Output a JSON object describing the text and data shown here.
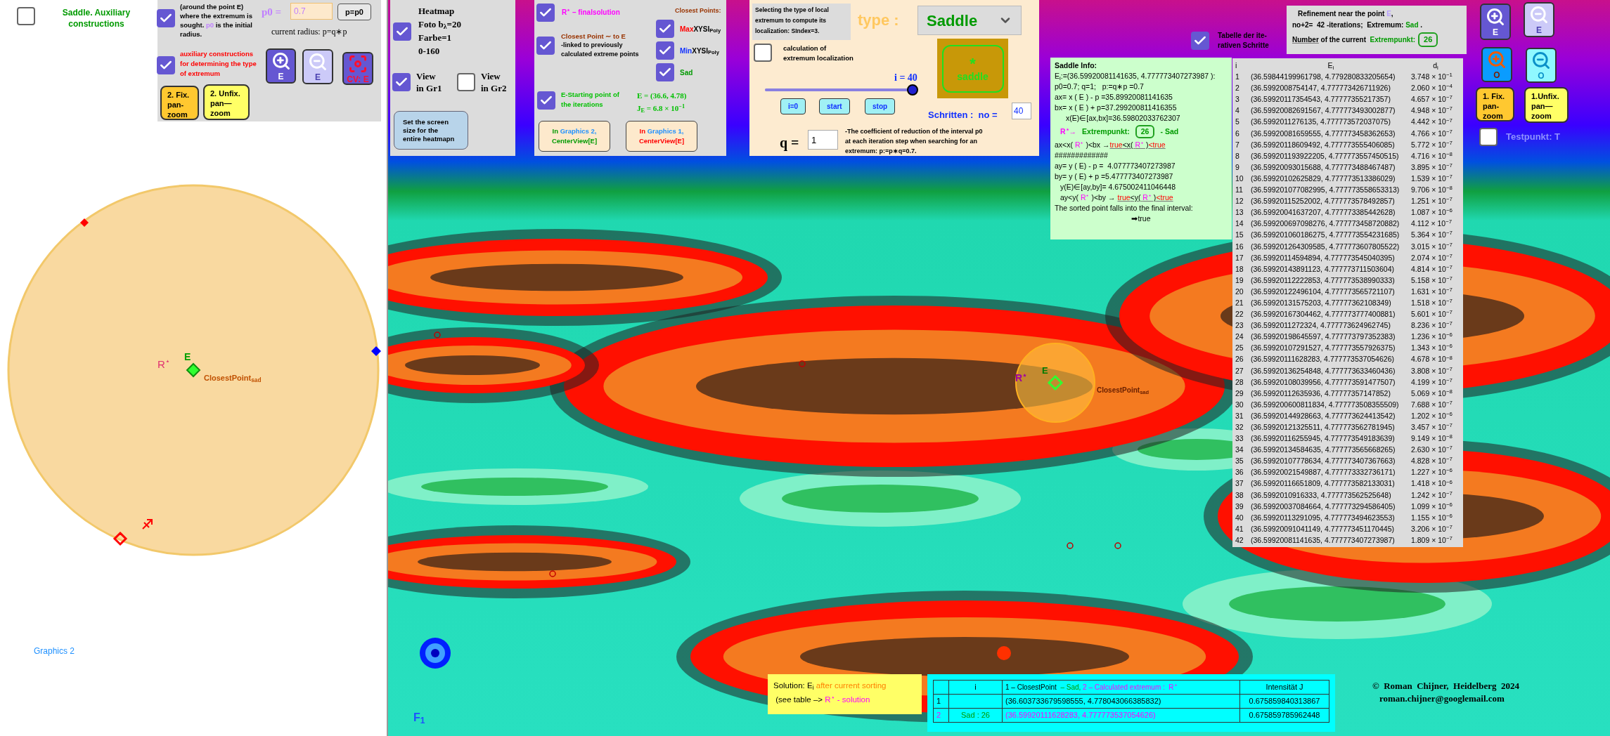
{
  "graphics_2": {
    "aux_checkbox": {
      "checked": false,
      "label": "Saddle. Auxiliary constructions"
    },
    "labels": {
      "r_star": "R$^{⋆}$",
      "e": "E",
      "closest": "ClosestPoint$_{sad}$"
    },
    "view_label": "Graphics 2"
  },
  "radius_panel": {
    "radius_option": {
      "checked": true,
      "segs": [
        {
          "t": "(around the point E) where the extremum is sought. ",
          "kind": "dark"
        },
        {
          "t": "p0",
          "kind": "violet"
        },
        {
          "t": " is the initial radius.",
          "kind": "dark"
        }
      ]
    },
    "p0_label": "p0 =",
    "p0_value": "0.7",
    "p0_button": "p=p0",
    "radius_text": "current radius: p=q∗p",
    "aux_option": {
      "checked": true,
      "label": "auxiliary constructions for determining the type of extremum"
    },
    "zoom_buttons": [
      {
        "kind": "zoom_in",
        "label": "E"
      },
      {
        "kind": "zoom_out",
        "label": "E"
      },
      {
        "kind": "center",
        "label": "CV: E"
      }
    ],
    "pan_buttons": [
      {
        "kind": "fix",
        "label": "2. Fix.\npan-\nzoom"
      },
      {
        "kind": "unfix",
        "label": "2. Unfix.\npan—\nzoom"
      }
    ]
  },
  "heatmap_panel": {
    "heatmap": {
      "checked": true,
      "lines": [
        "Heatmap",
        "Foto b$_{λ}$=20",
        "Farbe=1",
        "0-160"
      ]
    },
    "views": [
      {
        "label": "View\nin Gr1",
        "checked": true
      },
      {
        "label": "View\nin Gr2",
        "checked": false
      }
    ],
    "screen_button": "Set the screen\n size for the\nentire heatmapn"
  },
  "points_panel": {
    "final_solution": {
      "checked": true,
      "label": "R$^{⋆}$ – finalsolution"
    },
    "closest_heading": "Closest Points:",
    "closest_point": {
      "checked": true,
      "title": "Closest Point ∼ to E",
      "note": "-linked to previously calculated extreme points"
    },
    "poly_options": [
      {
        "kind": "max",
        "checked": true,
        "prefix": "Max",
        "label": "XYSI$_{Poly}$"
      },
      {
        "kind": "min",
        "checked": true,
        "prefix": "Min",
        "label": "XYSI$_{Poly}$"
      },
      {
        "kind": "sad",
        "checked": true,
        "label": "Sad"
      }
    ],
    "starting": {
      "checked": true,
      "label": "E-Starting point of the iterations",
      "e_value": "E = (36.6, 4.78)",
      "j_value": "J$_{E}$ = 6.8 × 10$^{−1}$"
    },
    "center_buttons": [
      {
        "segs": [
          {
            "t": "In ",
            "kind": "green"
          },
          {
            "t": "Graphics 2,",
            "kind": "blue"
          },
          {
            "t": "\nCenterView[E]",
            "kind": "green"
          }
        ]
      },
      {
        "segs": [
          {
            "t": "In ",
            "kind": "red"
          },
          {
            "t": "Graphics 1,",
            "kind": "blue"
          },
          {
            "t": "\nCenterView[E]",
            "kind": "red"
          }
        ]
      }
    ]
  },
  "type_panel": {
    "hint": "Selecting the type of local extremum to compute its localization: SIndex=3.",
    "type_label": "type :",
    "type_value": "Saddle",
    "calc_option": {
      "checked": false,
      "label": "calculation of\nextremum localization"
    },
    "slider": {
      "label": "i = 40",
      "level": 1
    },
    "buttons": [
      "i=0",
      "start",
      "stop"
    ],
    "badge": {
      "symbol": "*",
      "label": "saddle"
    },
    "steps": {
      "label": "Schritten :  no =",
      "value": "40"
    },
    "q": {
      "label": "q =",
      "value": "1"
    },
    "description": "-The coefficient of reduction of the interval p0\nat each iteration step when searching for an\nextremum: p:=p∗q=0.7."
  },
  "table_option": {
    "checked": true,
    "label": "Tabelle der ite-\nrativen Schritte"
  },
  "refinement": {
    "line1": [
      {
        "t": "Refinement near the point ",
        "kind": "dark"
      },
      {
        "t": "E",
        "kind": "lavender"
      },
      {
        "t": ",",
        "kind": "dark"
      }
    ],
    "line2": [
      {
        "t": "no+2=  42 -iterations;  Extremum: ",
        "kind": "dark"
      },
      {
        "t": "Sad",
        "kind": "green"
      },
      {
        "t": " .",
        "kind": "dark"
      }
    ],
    "line3": [
      {
        "t": "Number",
        "kind": "dark",
        "u": true
      },
      {
        "t": " of the current  ",
        "kind": "dark"
      },
      {
        "t": "Extrempunkt:",
        "kind": "green"
      }
    ],
    "value": "26"
  },
  "saddle_info": {
    "title": "Saddle  Info:",
    "lines_top": [
      {
        "segs": [
          {
            "t": "E$_{i}$:=(36.59920081141635, 4.777773407273987 ):",
            "kind": "dark"
          }
        ]
      },
      {
        "segs": [
          {
            "t": "p0=0.7; q=1;   p:=q∗p =0.7",
            "kind": "dark"
          }
        ]
      },
      {
        "segs": [
          {
            "t": "ax= x ( E ) - p =35.89920081141635",
            "kind": "dark"
          }
        ]
      },
      {
        "segs": [
          {
            "t": "bx= x ( E ) + p=37.299200811416355",
            "kind": "dark"
          }
        ]
      },
      {
        "indent": true,
        "segs": [
          {
            "t": "x(E)∈[ax,bx]=36.59802033762307",
            "kind": "dark"
          }
        ]
      }
    ],
    "extrem": {
      "arrow": "R$^{⋆}$→",
      "label": "Extrempunkt:",
      "value": "26",
      "suffix": "- Sad"
    },
    "lines_bottom": [
      {
        "segs": [
          {
            "t": "ax<x( ",
            "kind": "dark"
          },
          {
            "t": "R$^{⋆}$",
            "kind": "magenta"
          },
          {
            "t": " )<bx →",
            "kind": "dark"
          },
          {
            "t": "true",
            "kind": "red",
            "u": true
          },
          {
            "t": "<x( ",
            "kind": "dark",
            "u": true
          },
          {
            "t": "R$^{⋆}$",
            "kind": "magenta",
            "u": true
          },
          {
            "t": " )",
            "kind": "dark",
            "u": true
          },
          {
            "t": "<true",
            "kind": "red",
            "u": true
          }
        ]
      },
      {
        "segs": [
          {
            "t": "#############",
            "kind": "dark"
          }
        ]
      },
      {
        "segs": [
          {
            "t": "ay= y ( E) - p =  4.077773407273987",
            "kind": "dark"
          }
        ]
      },
      {
        "segs": [
          {
            "t": "by= y ( E) + p =5.477773407273987",
            "kind": "dark"
          }
        ]
      },
      {
        "indent": true,
        "segs": [
          {
            "t": "y(E)∈[ay,by]= 4.675002411046448",
            "kind": "dark"
          }
        ]
      },
      {
        "indent": true,
        "segs": [
          {
            "t": "ay<y( ",
            "kind": "dark"
          },
          {
            "t": "R$^{⋆}$",
            "kind": "magenta"
          },
          {
            "t": " )<by → ",
            "kind": "dark"
          },
          {
            "t": "true",
            "kind": "red",
            "u": true
          },
          {
            "t": "<y( ",
            "kind": "dark",
            "u": true
          },
          {
            "t": "R$^{⋆}$",
            "kind": "magenta",
            "u": true
          },
          {
            "t": " )",
            "kind": "dark",
            "u": true
          },
          {
            "t": "<true",
            "kind": "red",
            "u": true
          }
        ]
      },
      {
        "segs": [
          {
            "t": "The sorted point falls into the final interval:",
            "kind": "dark"
          }
        ]
      },
      {
        "center": true,
        "segs": [
          {
            "t": "➡true",
            "kind": "dark"
          }
        ]
      }
    ]
  },
  "iteration_table": {
    "columns": [
      "i",
      "E$_{i}$",
      "d$_{i}$"
    ],
    "rows": [
      {
        "i": "1",
        "e": "(36.59844199961798, 4.779280833205654)",
        "d": "3.748 × 10$^{−1}$"
      },
      {
        "i": "2",
        "e": "(36.5992008754147, 4.777773426711926)",
        "d": "2.060 × 10$^{−4}$"
      },
      {
        "i": "3",
        "e": "(36.59920117354543, 4.77777355217357)",
        "d": "4.657 × 10$^{−7}$"
      },
      {
        "i": "4",
        "e": "(36.59920082691567, 4.777773493002877)",
        "d": "4.948 × 10$^{−7}$"
      },
      {
        "i": "5",
        "e": "(36.5992011276135, 4.777773572037075)",
        "d": "4.442 × 10$^{−7}$"
      },
      {
        "i": "6",
        "e": "(36.59920081659555, 4.777773458362653)",
        "d": "4.766 × 10$^{−7}$"
      },
      {
        "i": "7",
        "e": "(36.59920118609492, 4.777773555406085)",
        "d": "5.772 × 10$^{−7}$"
      },
      {
        "i": "8",
        "e": "(36.599201193922205, 4.777773557450515)",
        "d": "4.716 × 10$^{−8}$"
      },
      {
        "i": "9",
        "e": "(36.59920093015688, 4.777773488467487)",
        "d": "3.895 × 10$^{−7}$"
      },
      {
        "i": "10",
        "e": "(36.59920102625829, 4.777773513386029)",
        "d": "1.539 × 10$^{−7}$"
      },
      {
        "i": "11",
        "e": "(36.599201077082995, 4.777773558653313)",
        "d": "9.706 × 10$^{−8}$"
      },
      {
        "i": "12",
        "e": "(36.59920115252002, 4.777773578492857)",
        "d": "1.251 × 10$^{−7}$"
      },
      {
        "i": "13",
        "e": "(36.59920041637207, 4.777773385442628)",
        "d": "1.087 × 10$^{−6}$"
      },
      {
        "i": "14",
        "e": "(36.599200697098276, 4.777773458720882)",
        "d": "4.112 × 10$^{−7}$"
      },
      {
        "i": "15",
        "e": "(36.599201060186275, 4.777773554231685)",
        "d": "5.364 × 10$^{−7}$"
      },
      {
        "i": "16",
        "e": "(36.599201264309585, 4.777773607805522)",
        "d": "3.015 × 10$^{−7}$"
      },
      {
        "i": "17",
        "e": "(36.59920114594894, 4.777773545040395)",
        "d": "2.074 × 10$^{−7}$"
      },
      {
        "i": "18",
        "e": "(36.59920143891123, 4.777773711503604)",
        "d": "4.814 × 10$^{−7}$"
      },
      {
        "i": "19",
        "e": "(36.59920112222853, 4.777773538990333)",
        "d": "5.158 × 10$^{−7}$"
      },
      {
        "i": "20",
        "e": "(36.59920122496104, 4.777773565721107)",
        "d": "1.631 × 10$^{−7}$"
      },
      {
        "i": "21",
        "e": "(36.59920131575203, 4.77777362108349)",
        "d": "1.518 × 10$^{−7}$"
      },
      {
        "i": "22",
        "e": "(36.59920167304462, 4.777773777400881)",
        "d": "5.601 × 10$^{−7}$"
      },
      {
        "i": "23",
        "e": "(36.5992011272324, 4.777773624962745)",
        "d": "8.236 × 10$^{−7}$"
      },
      {
        "i": "24",
        "e": "(36.59920198645597, 4.777773797352383)",
        "d": "1.236 × 10$^{−6}$"
      },
      {
        "i": "25",
        "e": "(36.59920107291527, 4.777773557926375)",
        "d": "1.343 × 10$^{−6}$"
      },
      {
        "i": "26",
        "e": "(36.59920111628283, 4.777773537054626)",
        "d": "4.678 × 10$^{−8}$"
      },
      {
        "i": "27",
        "e": "(36.59920136254848, 4.777773633460436)",
        "d": "3.808 × 10$^{−7}$"
      },
      {
        "i": "28",
        "e": "(36.59920108039956, 4.777773591477507)",
        "d": "4.199 × 10$^{−7}$"
      },
      {
        "i": "29",
        "e": "(36.59920112635936, 4.77777357147852)",
        "d": "5.069 × 10$^{−8}$"
      },
      {
        "i": "30",
        "e": "(36.599200600811834, 4.777773508355509)",
        "d": "7.688 × 10$^{−7}$"
      },
      {
        "i": "31",
        "e": "(36.59920144928663, 4.777773624413542)",
        "d": "1.202 × 10$^{−6}$"
      },
      {
        "i": "32",
        "e": "(36.59920121325511, 4.777773562781945)",
        "d": "3.457 × 10$^{−7}$"
      },
      {
        "i": "33",
        "e": "(36.59920116255945, 4.777773549183639)",
        "d": "9.149 × 10$^{−8}$"
      },
      {
        "i": "34",
        "e": "(36.59920134584635, 4.777773565668265)",
        "d": "2.630 × 10$^{−7}$"
      },
      {
        "i": "35",
        "e": "(36.59920107778634, 4.777773407367663)",
        "d": "4.828 × 10$^{−7}$"
      },
      {
        "i": "36",
        "e": "(36.59920021549887, 4.777773332736171)",
        "d": "1.227 × 10$^{−6}$"
      },
      {
        "i": "37",
        "e": "(36.59920116651809, 4.777773582133031)",
        "d": "1.418 × 10$^{−6}$"
      },
      {
        "i": "38",
        "e": "(36.5992010916333, 4.777773562525648)",
        "d": "1.242 × 10$^{−7}$"
      },
      {
        "i": "39",
        "e": "(36.59920037084664, 4.777773294586405)",
        "d": "1.099 × 10$^{−6}$"
      },
      {
        "i": "40",
        "e": "(36.59920113291095, 4.777773494623553)",
        "d": "1.155 × 10$^{−6}$"
      },
      {
        "i": "41",
        "e": "(36.59920091041149, 4.777773451170445)",
        "d": "3.206 × 10$^{−7}$"
      },
      {
        "i": "42",
        "e": "(36.59920081141635, 4.777773407273987)",
        "d": "1.809 × 10$^{−7}$"
      }
    ]
  },
  "right_controls": {
    "zoom_buttons": [
      {
        "kind": "zoom_in",
        "label": "E"
      },
      {
        "kind": "zoom_out",
        "label": "E"
      },
      {
        "kind": "zoom_in_alt",
        "label": "O"
      },
      {
        "kind": "zoom_out_alt",
        "label": "O"
      }
    ],
    "pan_buttons": [
      {
        "kind": "fix",
        "label": "1. Fix.\npan-\nzoom"
      },
      {
        "kind": "unfix",
        "label": "1.Unfix.\npan—\nzoom"
      }
    ],
    "test_point": {
      "checked": false,
      "label": "Testpunkt: T"
    }
  },
  "graphics_1": {
    "labels": {
      "r_star": "R$^{⋆}$",
      "e": "E",
      "closest": "ClosestPoint$_{sad}$",
      "f1": "F$_{1}$"
    }
  },
  "solution_note": {
    "line1": [
      {
        "t": "Solution: E$_{i}$",
        "kind": "dark"
      },
      {
        "t": " after current sorting",
        "kind": "orange"
      }
    ],
    "line2": [
      {
        "t": " (see table –> ",
        "kind": "dark"
      },
      {
        "t": "R$^{⋆}$ - solution",
        "kind": "magenta"
      }
    ]
  },
  "result_table": {
    "columns": [
      {
        "segs": [
          {
            "t": "i",
            "kind": "dark"
          }
        ]
      },
      {
        "segs": [
          {
            "t": "1 – ClosestPoint ",
            "kind": "dark"
          },
          {
            "t": " – Sad, ",
            "kind": "green"
          },
          {
            "t": "2 – Calculated extremum :  R$^{⋆}$",
            "kind": "magenta"
          }
        ]
      },
      {
        "segs": [
          {
            "t": "Intensität J",
            "kind": "dark"
          }
        ]
      }
    ],
    "rows": [
      {
        "kind": "closest",
        "n": "1",
        "point": "(36.603733679598555, 4.778043066385832)",
        "j": "0.675859840313867"
      },
      {
        "kind": "calculated",
        "n": "2",
        "i": "Sad : 26",
        "point": "(36.59920111628283, 4.777773537054626)",
        "j": "0.675859785962448"
      }
    ]
  },
  "copyright": {
    "line1": "©  Roman  Chijner,  Heidelberg  2024",
    "line2": "roman.chijner@googlemail.com"
  }
}
